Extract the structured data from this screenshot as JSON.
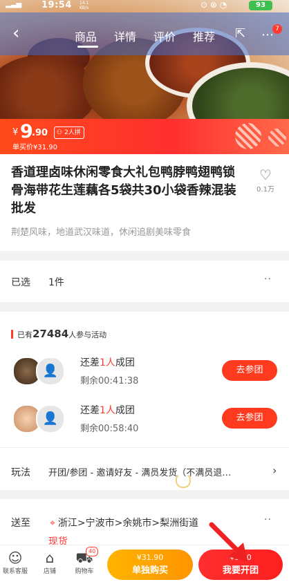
{
  "status_bar": {
    "time": "19:54",
    "speed": "14.1 KB/s",
    "battery": "93"
  },
  "nav": {
    "tabs": [
      {
        "label": "商品",
        "active": true
      },
      {
        "label": "详情",
        "active": false
      },
      {
        "label": "评价",
        "active": false
      },
      {
        "label": "推荐",
        "active": false
      }
    ],
    "more_badge": "7"
  },
  "price": {
    "currency": "¥",
    "integer": "9",
    "decimal": ".90",
    "group_tag": "2人拼",
    "single_price": "单买价¥31.90"
  },
  "product": {
    "title": "香道理卤味休闲零食大礼包鸭脖鸭翅鸭锁骨海带花生莲藕各5袋共30小袋香辣混装批发",
    "subtitle": "荆楚风味，地道武汉味道，休闲追剧美味零食",
    "fav_count": "0.1万"
  },
  "selection": {
    "label": "已选",
    "value": "1件"
  },
  "group_buy": {
    "header_prefix": "已有",
    "participants": "27484",
    "header_suffix": "人参与活动",
    "groups": [
      {
        "need_prefix": "还差",
        "need_count": "1人",
        "need_suffix": "成团",
        "remaining": "剩余00:41:38",
        "button": "去参团"
      },
      {
        "need_prefix": "还差",
        "need_count": "1人",
        "need_suffix": "成团",
        "remaining": "剩余00:58:40",
        "button": "去参团"
      }
    ],
    "rules_label": "玩法",
    "rules_text": "开团/参团 - 邀请好友 - 满员发货（不满员退…"
  },
  "shipping": {
    "label": "送至",
    "location": "浙江>宁波市>余姚市>梨洲街道",
    "stock": "现货"
  },
  "bottom_bar": {
    "service_label": "联系客服",
    "shop_label": "店铺",
    "cart_label": "购物车",
    "cart_badge": "40",
    "single_buy_price": "¥31.90",
    "single_buy_label": "单独购买",
    "group_buy_price": "¥9.90",
    "group_buy_label": "我要开团"
  },
  "colors": {
    "accent": "#ff3a1f",
    "orange": "#ffa800"
  }
}
